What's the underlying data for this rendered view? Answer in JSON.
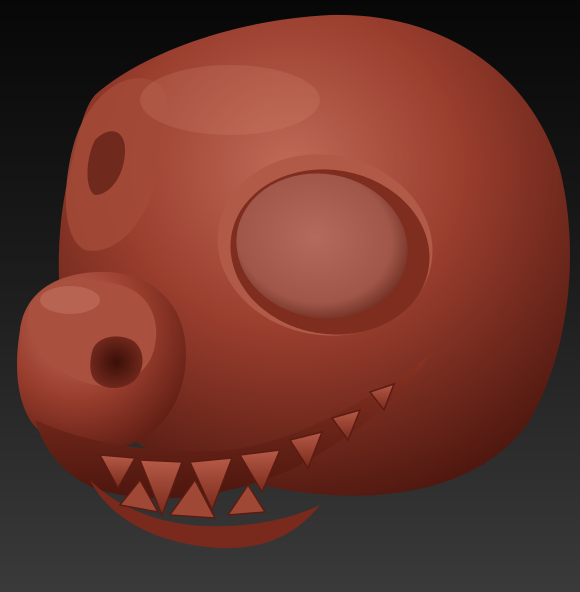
{
  "scene": {
    "subject_icon": "sculpted-creature-head-icon",
    "colors": {
      "background_top": "#070707",
      "background_bottom": "#3a3a3a",
      "clay_base": "#8e3526",
      "clay_highlight": "#c4705e",
      "clay_shadow": "#3c110b",
      "eye_socket": "#a55a4c"
    }
  }
}
